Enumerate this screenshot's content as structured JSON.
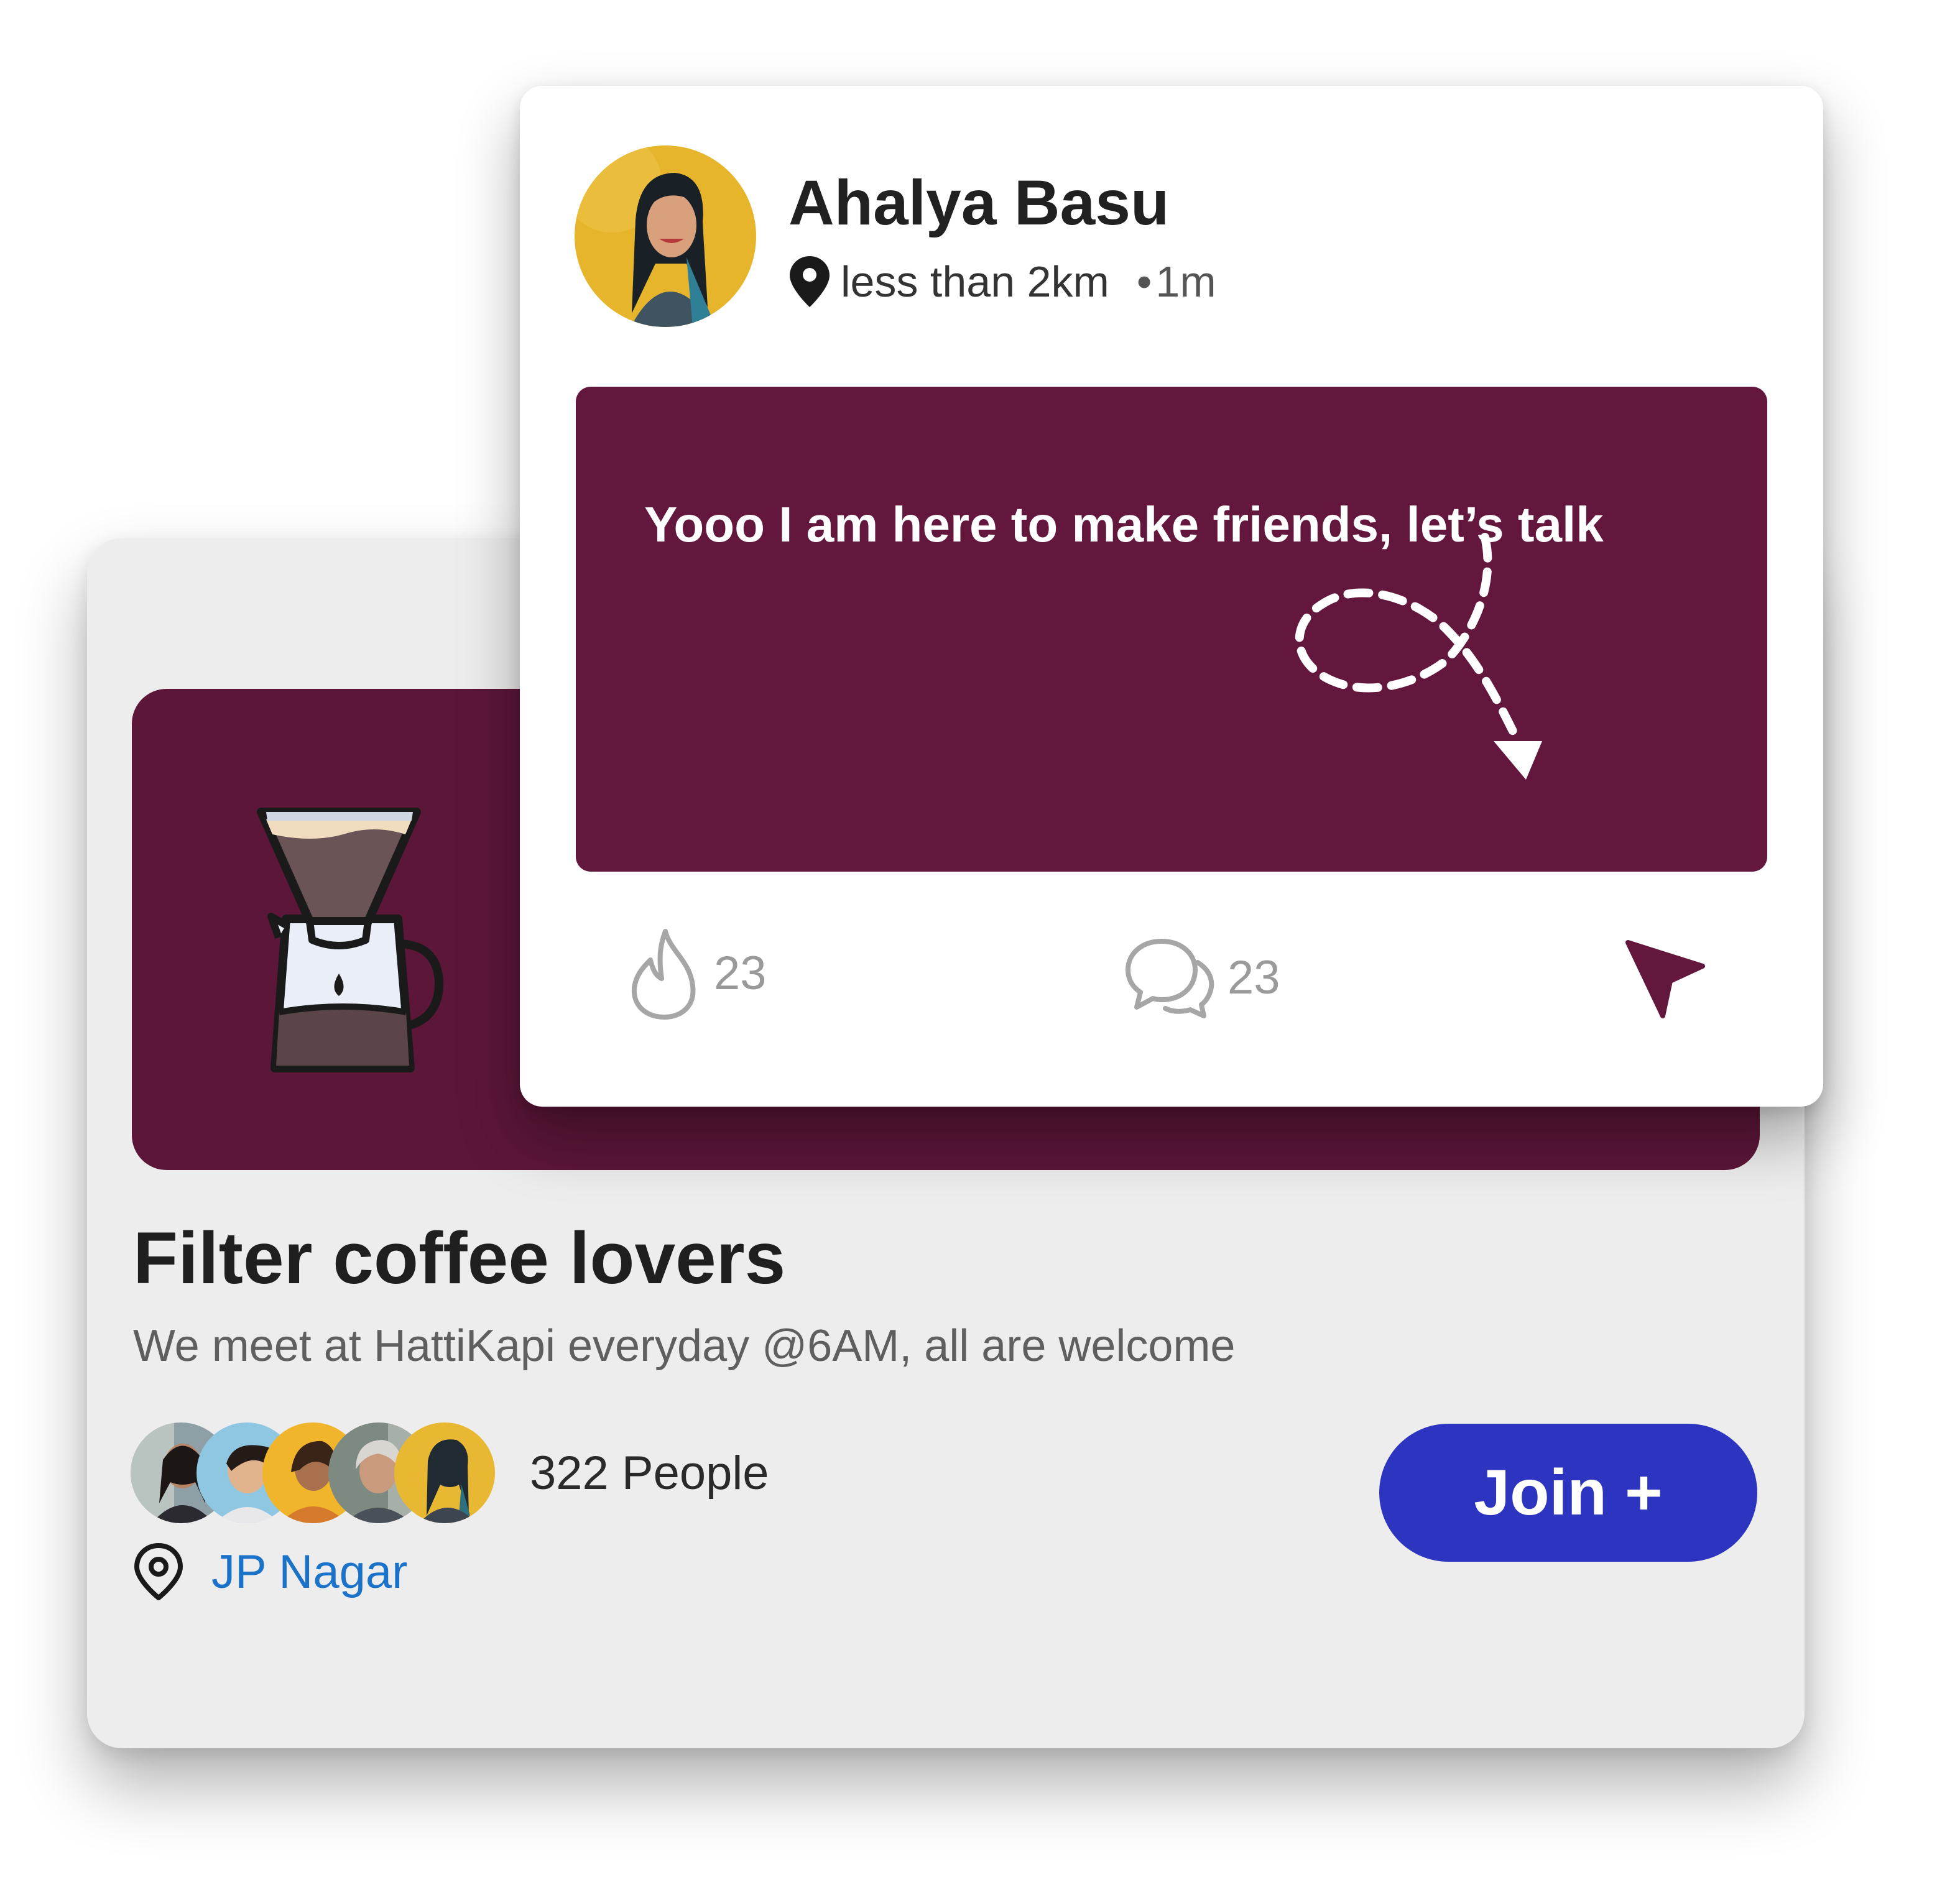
{
  "post": {
    "author_name": "Ahalya Basu",
    "distance": "less than 2km",
    "separator": "•",
    "time_ago": "1m",
    "message": "Yooo I am here to make friends, let’s talk",
    "likes_count": "23",
    "comments_count": "23",
    "icons": {
      "location": "location-pin-icon",
      "like": "flame-icon",
      "comment": "chat-bubbles-icon",
      "share": "send-arrow-icon",
      "decoration": "dashed-loop-arrow"
    }
  },
  "group": {
    "title": "Filter coffee lovers",
    "description": "We meet at HattiKapi everyday @6AM, all are welcome",
    "members_count_label": "322 People",
    "location": "JP Nagar",
    "join_label": "Join +",
    "banner_icon": "coffee-dripper-icon",
    "member_avatars": [
      "member-1",
      "member-2",
      "member-3",
      "member-4",
      "member-5"
    ]
  },
  "colors": {
    "banner": "#5c1638",
    "post_body": "#63173d",
    "join_button": "#2d35c0",
    "location_link": "#1a73c8",
    "card_background": "#ededed"
  }
}
